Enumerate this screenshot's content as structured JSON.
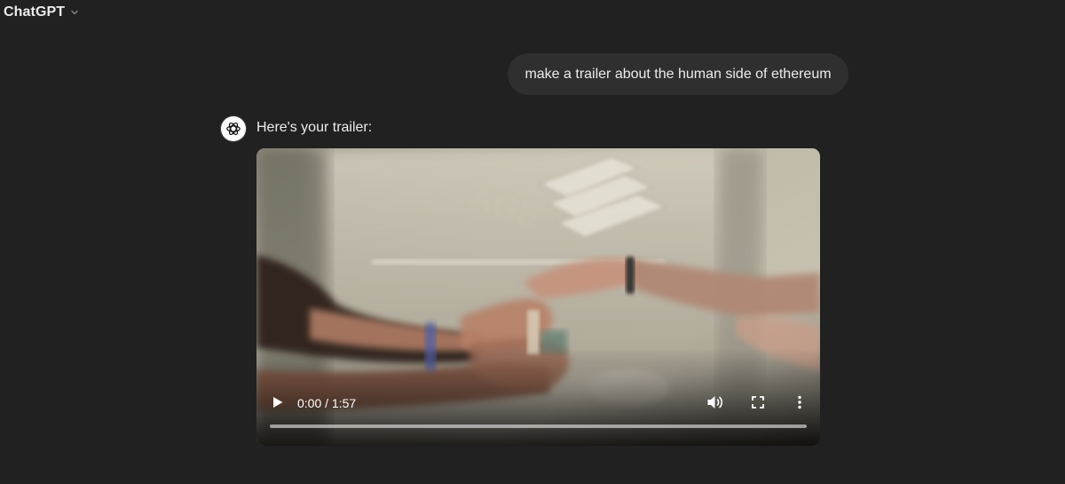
{
  "header": {
    "app_title": "ChatGPT",
    "model_menu_icon": "chevron-down-icon"
  },
  "conversation": {
    "user_message": "make a trailer about the human side of ethereum",
    "assistant": {
      "avatar_icon": "openai-logo-icon",
      "intro_text": "Here's your trailer:",
      "video_player": {
        "time_display": "0:00 / 1:57",
        "progress_fraction": 0,
        "icons": [
          "play-icon",
          "volume-icon",
          "fullscreen-icon",
          "more-options-icon"
        ]
      }
    }
  },
  "colors": {
    "background": "#212121",
    "user_bubble": "#2f2f2f",
    "text": "#ececec"
  }
}
